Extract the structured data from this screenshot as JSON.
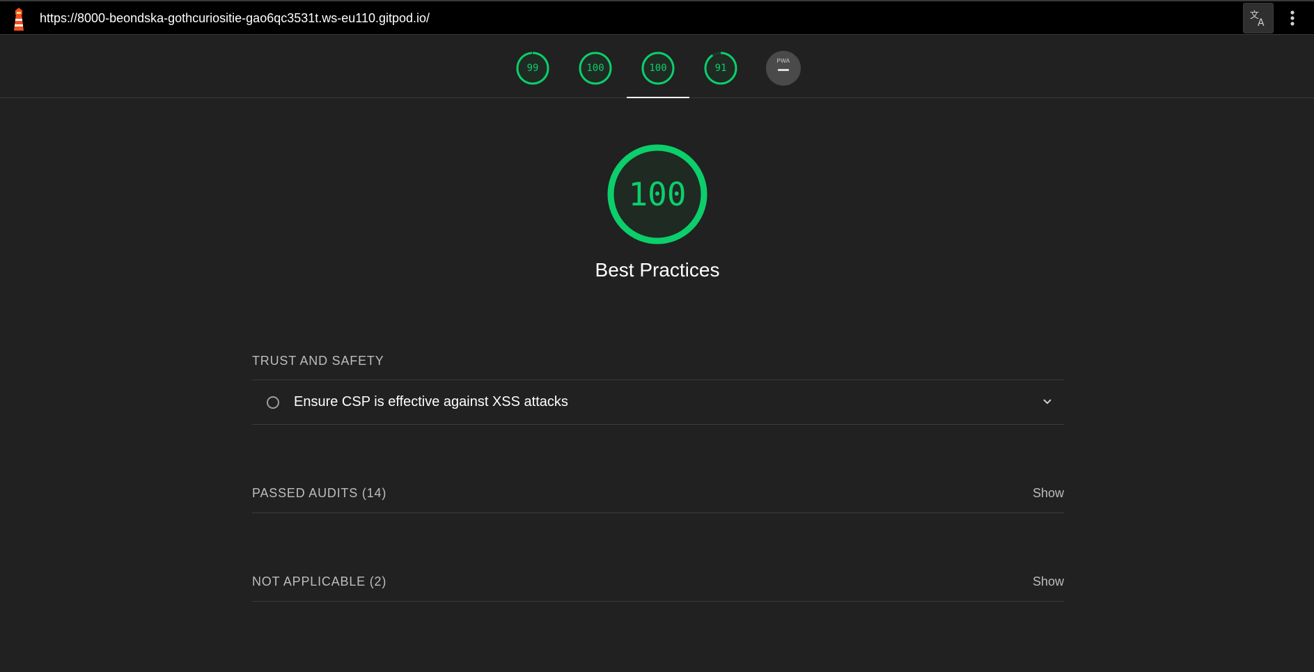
{
  "browser": {
    "url": "https://8000-beondska-gothcuriositie-gao6qc3531t.ws-eu110.gitpod.io/",
    "logo_icon": "lighthouse-icon",
    "translate_icon": "translate-icon",
    "menu_icon": "more-vert-icon"
  },
  "gauges": [
    {
      "score": "99",
      "fraction": 0.99
    },
    {
      "score": "100",
      "fraction": 1.0
    },
    {
      "score": "100",
      "fraction": 1.0
    },
    {
      "score": "91",
      "fraction": 0.91
    }
  ],
  "pwa": {
    "label": "PWA"
  },
  "category": {
    "score": "100",
    "fraction": 1.0,
    "title": "Best Practices"
  },
  "groups": {
    "trust_safety": {
      "title": "TRUST AND SAFETY",
      "audit_title": "Ensure CSP is effective against XSS attacks"
    },
    "passed": {
      "title": "PASSED AUDITS (14)",
      "show_label": "Show"
    },
    "not_applicable": {
      "title": "NOT APPLICABLE (2)",
      "show_label": "Show"
    }
  },
  "colors": {
    "pass": "#0cce6b",
    "background": "#212121",
    "topbar": "#000000"
  }
}
